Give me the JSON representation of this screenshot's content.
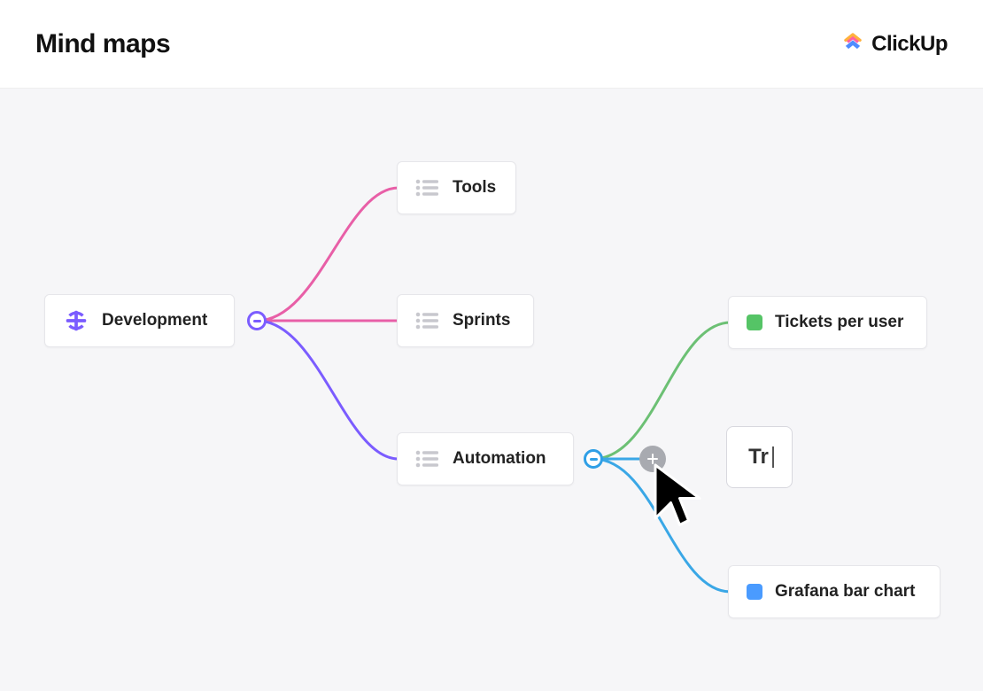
{
  "header": {
    "title": "Mind maps",
    "brand": "ClickUp"
  },
  "nodes": {
    "root": {
      "label": "Development"
    },
    "tools": {
      "label": "Tools"
    },
    "sprints": {
      "label": "Sprints"
    },
    "automation": {
      "label": "Automation"
    },
    "tickets": {
      "label": "Tickets per user"
    },
    "grafana": {
      "label": "Grafana bar chart"
    }
  },
  "typing": {
    "value": "Tr"
  },
  "colors": {
    "edge_pink": "#e85fa7",
    "edge_purple": "#7b5cff",
    "edge_blue": "#3aa7e6",
    "edge_green": "#6cc074",
    "status_green": "#55c466",
    "status_blue": "#4a9bff",
    "globe": "#7b5cff"
  }
}
